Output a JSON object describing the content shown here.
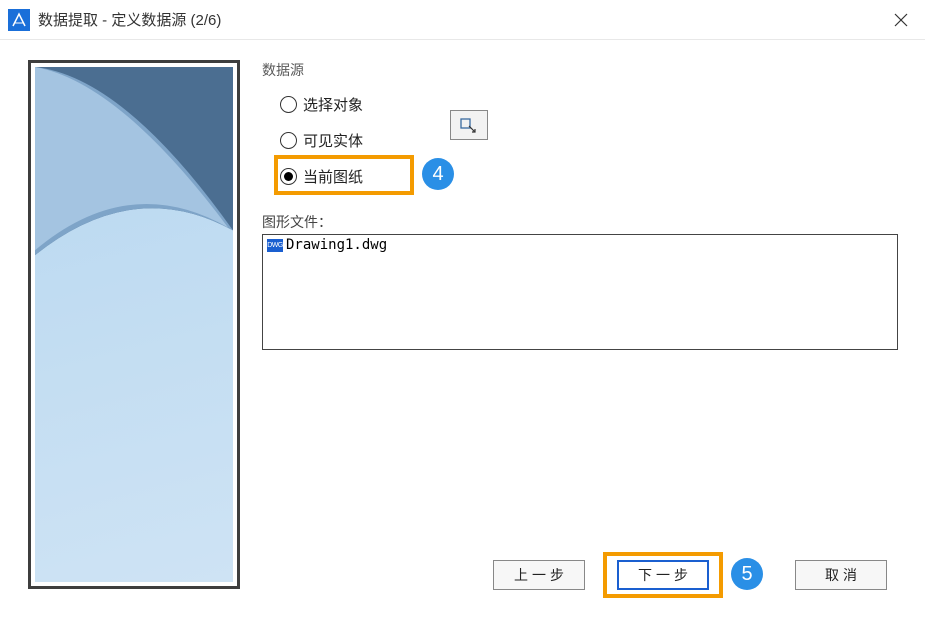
{
  "window": {
    "title": "数据提取 - 定义数据源 (2/6)"
  },
  "data_source": {
    "group_label": "数据源",
    "options": {
      "select_objects": "选择对象",
      "visible_entities": "可见实体",
      "current_drawing": "当前图纸"
    }
  },
  "files": {
    "label": "图形文件：",
    "items": [
      "Drawing1.dwg"
    ]
  },
  "buttons": {
    "prev": "上一步",
    "next": "下一步",
    "cancel": "取消"
  },
  "callouts": {
    "c4": "4",
    "c5": "5"
  }
}
